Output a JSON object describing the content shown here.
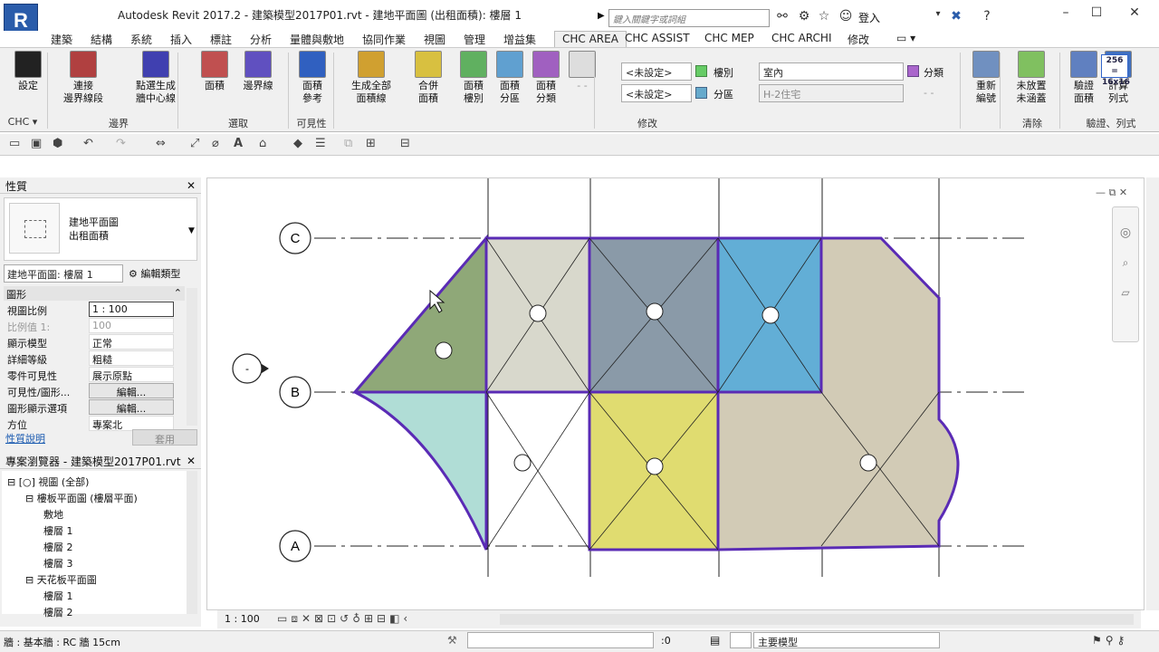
{
  "app": {
    "logo": "R",
    "title": "Autodesk Revit 2017.2 -     建築模型2017P01.rvt - 建地平面圖 (出租面積): 樓層 1",
    "search_placeholder": "鍵入關鍵字或詞組",
    "login": "登入"
  },
  "tabs": [
    "建築",
    "結構",
    "系統",
    "插入",
    "標註",
    "分析",
    "量體與敷地",
    "協同作業",
    "視圖",
    "管理",
    "增益集",
    "CHC AREA",
    "CHC ASSIST",
    "CHC MEP",
    "CHC ARCHI",
    "修改"
  ],
  "ribbon": {
    "buttons": [
      {
        "label": "設定"
      },
      {
        "label": "連接\n邊界線段"
      },
      {
        "label": "點選生成\n牆中心線"
      },
      {
        "label": "面積"
      },
      {
        "label": "邊界線"
      },
      {
        "label": "面積\n參考"
      },
      {
        "label": "生成全部\n面積線"
      },
      {
        "label": "合併\n面積"
      },
      {
        "label": "面積\n樓別"
      },
      {
        "label": "面積\n分區"
      },
      {
        "label": "面積\n分類"
      },
      {
        "label": "- -"
      },
      {
        "label": "重新\n編號"
      },
      {
        "label": "未放置\n未涵蓋"
      },
      {
        "label": "驗證\n面積"
      },
      {
        "label": "計算\n列式"
      }
    ],
    "groups": [
      "CHC ▾",
      "邊界",
      "選取",
      "可見性",
      "修改",
      "清除",
      "驗證、列式"
    ],
    "combo1": "<未設定>",
    "combo2": "<未設定>",
    "lbl_floor": "樓別",
    "lbl_zone": "分區",
    "field_room": "室內",
    "field_type": "H-2住宅",
    "lbl_class": "分類",
    "lbl_dash": "- -",
    "calc_badge": "256 = 16x16"
  },
  "properties": {
    "title": "性質",
    "type_name": "建地平面圖\n出租面積",
    "selector": "建地平面圖: 樓層 1",
    "edit_type": "編輯類型",
    "section": "圖形",
    "rows": [
      {
        "k": "視圖比例",
        "v": "1 : 100"
      },
      {
        "k": "比例值 1:",
        "v": "100"
      },
      {
        "k": "顯示模型",
        "v": "正常"
      },
      {
        "k": "詳細等級",
        "v": "粗糙"
      },
      {
        "k": "零件可見性",
        "v": "展示原點"
      },
      {
        "k": "可見性/圖形...",
        "v": "編輯..."
      },
      {
        "k": "圖形顯示選項",
        "v": "編輯..."
      },
      {
        "k": "方位",
        "v": "專案北"
      }
    ],
    "help": "性質說明",
    "apply": "套用"
  },
  "browser": {
    "title": "專案瀏覽器 - 建築模型2017P01.rvt",
    "items": [
      {
        "label": "[○] 視圖 (全部)",
        "indent": 0
      },
      {
        "label": "樓板平面圖 (樓層平面)",
        "indent": 1
      },
      {
        "label": "敷地",
        "indent": 2
      },
      {
        "label": "樓層 1",
        "indent": 2
      },
      {
        "label": "樓層 2",
        "indent": 2
      },
      {
        "label": "樓層 3",
        "indent": 2
      },
      {
        "label": "天花板平面圖",
        "indent": 1
      },
      {
        "label": "樓層 1",
        "indent": 2
      },
      {
        "label": "樓層 2",
        "indent": 2
      }
    ]
  },
  "grid": {
    "c": "C",
    "b": "B",
    "a": "A",
    "dash": "-"
  },
  "viewbar": {
    "scale": "1 : 100"
  },
  "status": {
    "left": "牆 : 基本牆 : RC 牆 15cm",
    "zero": ":0",
    "model": "主要模型"
  },
  "colors": {
    "boundary": "#5a2bb5",
    "green": "#8fa878",
    "light": "#d8d8cc",
    "slate": "#8a9aa8",
    "blue": "#62aed6",
    "tan": "#d2cbb6",
    "aqua": "#b0ddd6",
    "yellow": "#e0dc70"
  }
}
